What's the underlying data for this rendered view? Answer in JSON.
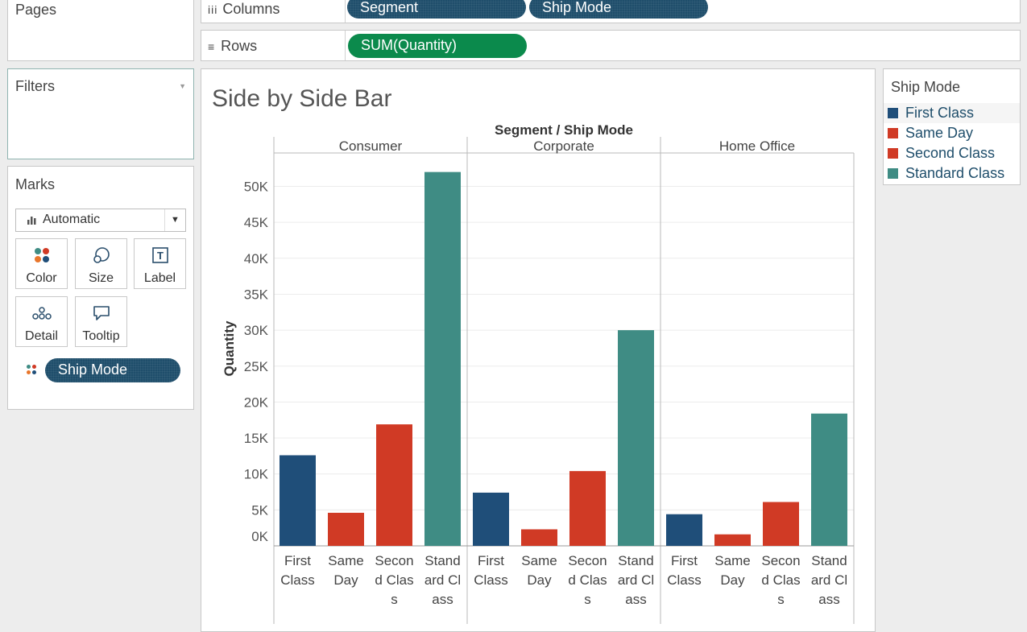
{
  "left_panel": {
    "pages_title": "Pages",
    "filters_title": "Filters",
    "marks_title": "Marks",
    "mark_type": "Automatic",
    "buttons": {
      "color": "Color",
      "size": "Size",
      "label": "Label",
      "detail": "Detail",
      "tooltip": "Tooltip"
    },
    "color_pill": "Ship Mode"
  },
  "shelves": {
    "columns_label": "Columns",
    "columns_pills": [
      "Segment",
      "Ship Mode"
    ],
    "rows_label": "Rows",
    "rows_pills": [
      "SUM(Quantity)"
    ]
  },
  "viz": {
    "title": "Side by Side Bar"
  },
  "legend": {
    "title": "Ship Mode",
    "items": [
      {
        "label": "First Class",
        "color": "#1f4e79"
      },
      {
        "label": "Same Day",
        "color": "#d03a25"
      },
      {
        "label": "Second Class",
        "color": "#d03a25"
      },
      {
        "label": "Standard Class",
        "color": "#3f8c84"
      }
    ]
  },
  "chart_data": {
    "type": "bar",
    "header_title": "Segment / Ship Mode",
    "ylabel": "Quantity",
    "ylim": [
      0,
      52000
    ],
    "yticks": [
      0,
      5000,
      10000,
      15000,
      20000,
      25000,
      30000,
      35000,
      40000,
      45000,
      50000
    ],
    "ytick_labels": [
      "0K",
      "5K",
      "10K",
      "15K",
      "20K",
      "25K",
      "30K",
      "35K",
      "40K",
      "45K",
      "50K"
    ],
    "categories": [
      "First Class",
      "Same Day",
      "Second Class",
      "Standard Class"
    ],
    "category_label_lines": [
      [
        "First",
        "Class"
      ],
      [
        "Same",
        "Day"
      ],
      [
        "Secon",
        "d Clas",
        "s"
      ],
      [
        "Stand",
        "ard Cl",
        "ass"
      ]
    ],
    "colors": [
      "#1f4e79",
      "#d03a25",
      "#d03a25",
      "#3f8c84"
    ],
    "panels": [
      {
        "name": "Consumer",
        "values": [
          12600,
          4600,
          16900,
          52000
        ]
      },
      {
        "name": "Corporate",
        "values": [
          7400,
          2300,
          10400,
          30000
        ]
      },
      {
        "name": "Home Office",
        "values": [
          4400,
          1600,
          6100,
          18400
        ]
      }
    ]
  }
}
